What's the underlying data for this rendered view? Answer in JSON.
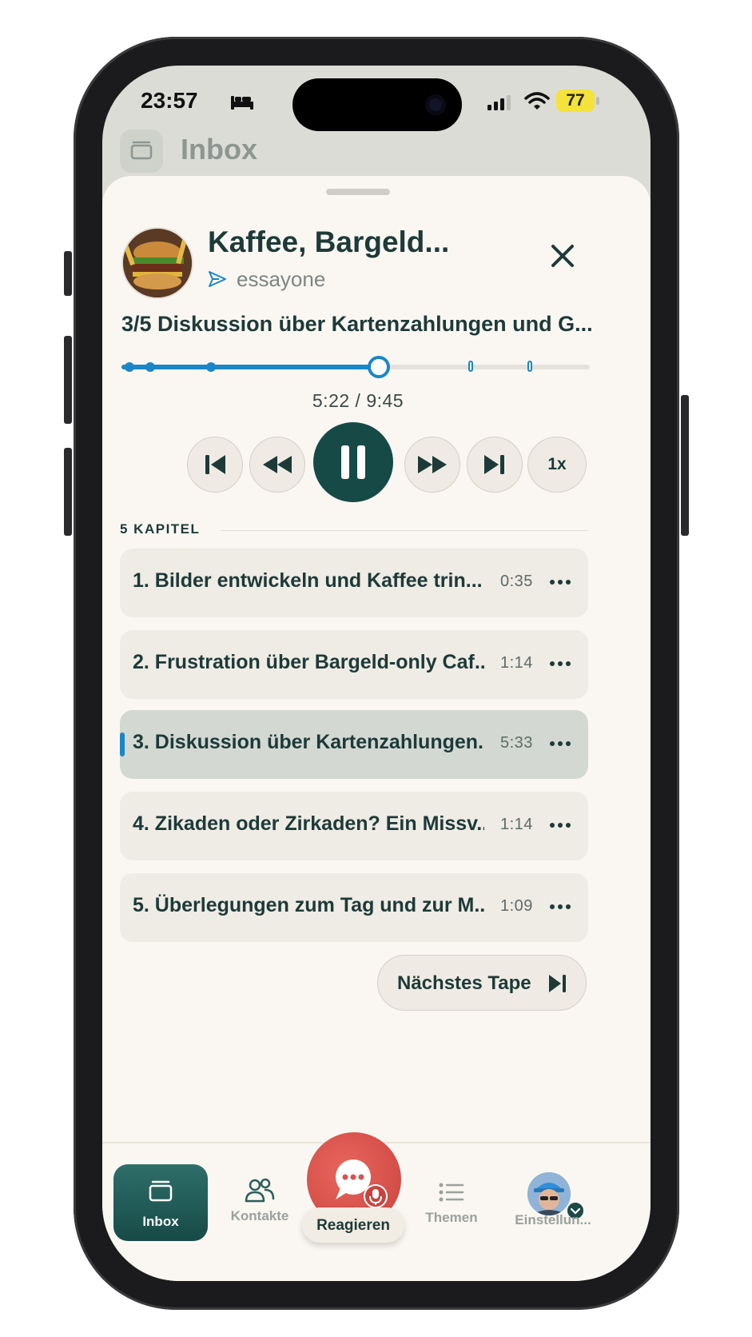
{
  "status_bar": {
    "time": "23:57",
    "battery": "77"
  },
  "header": {
    "title": "Inbox"
  },
  "player": {
    "episode_title": "Kaffee, Bargeld...",
    "author": "essayone",
    "chapter_title": "3/5 Diskussion über Kartenzahlungen und G...",
    "time_display": "5:22 / 9:45",
    "progress": 0.55,
    "speed": "1x"
  },
  "chapters": {
    "heading": "5 KAPITEL",
    "items": [
      {
        "label": "1. Bilder entwickeln und Kaffee trin...",
        "duration": "0:35",
        "active": false
      },
      {
        "label": "2. Frustration über Bargeld-only Caf...",
        "duration": "1:14",
        "active": false
      },
      {
        "label": "3. Diskussion über Kartenzahlungen...",
        "duration": "5:33",
        "active": true
      },
      {
        "label": "4. Zikaden oder Zirkaden? Ein Missv...",
        "duration": "1:14",
        "active": false
      },
      {
        "label": "5. Überlegungen zum Tag und zur M...",
        "duration": "1:09",
        "active": false
      }
    ]
  },
  "next_button": {
    "label": "Nächstes Tape"
  },
  "tabbar": {
    "inbox": "Inbox",
    "contacts": "Kontakte",
    "react": "Reagieren",
    "topics": "Themen",
    "settings": "Einstellun..."
  },
  "colors": {
    "accent": "#1a86c8",
    "primary": "#154a47",
    "react": "#d9534f"
  }
}
